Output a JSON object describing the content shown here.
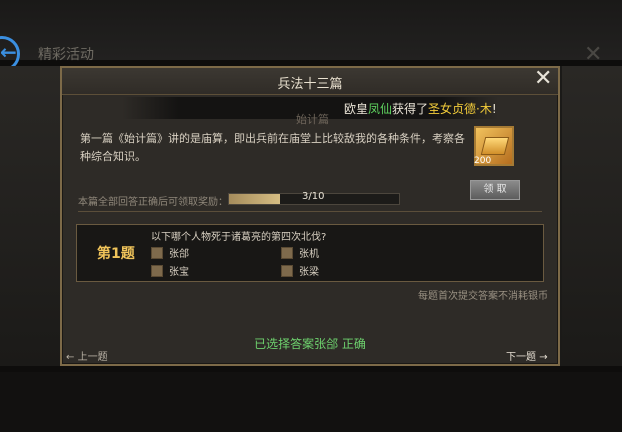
{
  "background": {
    "title": "精彩活动",
    "back_icon": "←",
    "close_icon": "✕"
  },
  "dialog": {
    "title": "兵法十三篇",
    "close_icon": "✕",
    "chapter_name": "始计篇",
    "ticker": {
      "prefix": "欧皇",
      "player": "凤仙",
      "middle": "获得了",
      "item": "圣女贞德·木",
      "suffix": "!"
    },
    "description": "第一篇《始计篇》讲的是庙算，即出兵前在庙堂上比较敌我的各种条件，考察各种综合知识。",
    "reward": {
      "icon": "gold-ingot-icon",
      "count": "200",
      "claim_label": "领 取"
    },
    "progress": {
      "label": "本篇全部回答正确后可领取奖励：",
      "current": 3,
      "total": 10,
      "text": "3/10",
      "fraction": 0.3
    },
    "question": {
      "number_label": "第1题",
      "text": "以下哪个人物死于诸葛亮的第四次北伐?",
      "options": [
        "张郃",
        "张机",
        "张宝",
        "张梁"
      ]
    },
    "note": "每题首次提交答案不消耗银币",
    "status": "已选择答案张郃 正确",
    "prev_label": "上一题",
    "next_label": "下一题",
    "prev_arrow": "←",
    "next_arrow": "→"
  },
  "colors": {
    "accent_gold": "#f0c45a",
    "correct_green": "#6ed26e",
    "player_name_green": "#5fd35f",
    "item_gold": "#f2cc3a"
  }
}
